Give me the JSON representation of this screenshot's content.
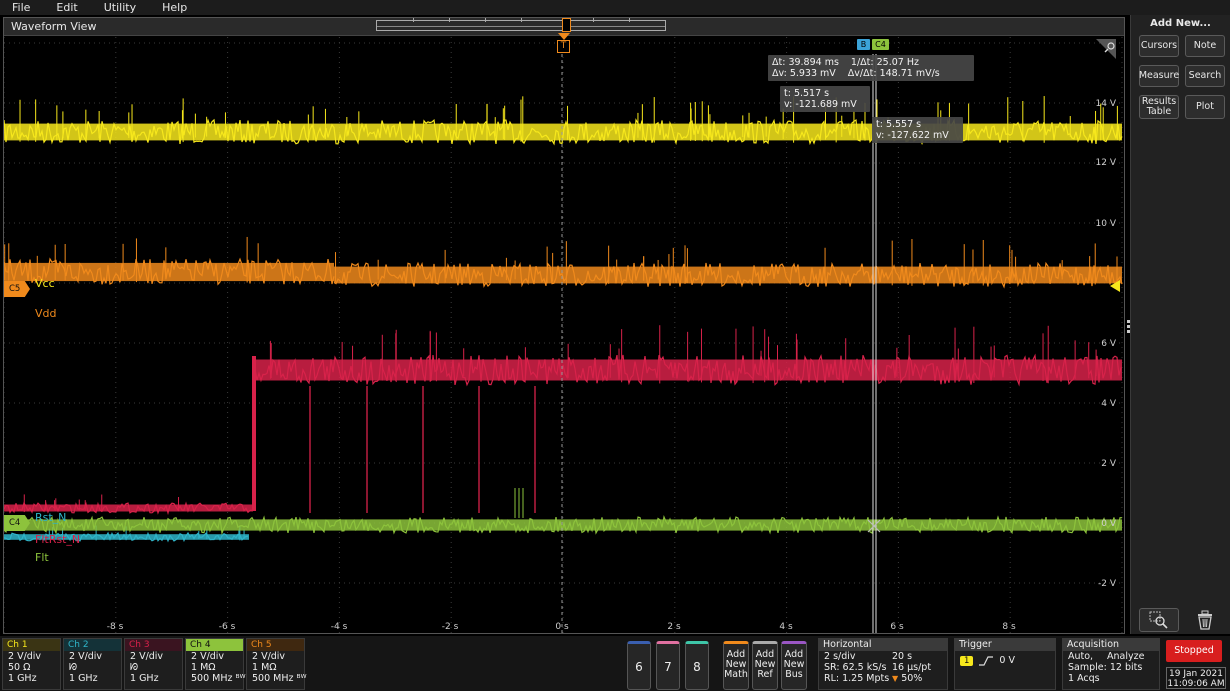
{
  "menu": [
    "File",
    "Edit",
    "Utility",
    "Help"
  ],
  "waveform_view": {
    "title": "Waveform View",
    "trigger_marker": "T",
    "y_labels": [
      "14 V",
      "12 V",
      "10 V",
      "6 V",
      "4 V",
      "2 V",
      "0 V",
      "-2 V"
    ],
    "x_labels": [
      "-8 s",
      "-6 s",
      "-4 s",
      "-2 s",
      "0 s",
      "2 s",
      "4 s",
      "6 s",
      "8 s"
    ],
    "cursor_badges": [
      "B",
      "C4"
    ],
    "delta_readout": {
      "dt": "Δt: 39.894 ms",
      "inv_dt": "1/Δt: 25.07 Hz",
      "dv": "Δv: 5.933 mV",
      "dv_dt": "Δv/Δt: 148.71 mV/s"
    },
    "cursor_a_readout": {
      "t": "t: 5.517 s",
      "v": "v: -121.689 mV"
    },
    "cursor_b_readout": {
      "t": "t: 5.557 s",
      "v": "v: -127.622 mV"
    },
    "channel_flags": {
      "c5": "C5",
      "c4": "C4"
    },
    "waveform_labels": {
      "vcc": "Vcc",
      "vdd": "Vdd",
      "rst": "Rst_N",
      "fltrst": "FltRst_N",
      "flt": "Flt"
    }
  },
  "right_panel": {
    "title": "Add New...",
    "buttons": [
      "Cursors",
      "Note",
      "Measure",
      "Search",
      "Results Table",
      "Plot"
    ]
  },
  "channels": [
    {
      "name": "Ch 1",
      "lines": [
        "2 V/div",
        "50 Ω",
        "1 GHz"
      ],
      "color": "#f7e81c"
    },
    {
      "name": "Ch 2",
      "lines": [
        "2 V/div",
        "ᘗ",
        "1 GHz"
      ],
      "color": "#2fb5c9"
    },
    {
      "name": "Ch 3",
      "lines": [
        "2 V/div",
        "ᘗ",
        "1 GHz"
      ],
      "color": "#d8224a"
    },
    {
      "name": "Ch 4",
      "lines": [
        "2 V/div",
        "1 MΩ",
        "500 MHz ᴮᵂ"
      ],
      "color": "#8dc33c"
    },
    {
      "name": "Ch 5",
      "lines": [
        "2 V/div",
        "1 MΩ",
        "500 MHz ᴮᵂ"
      ],
      "color": "#f08a1c"
    }
  ],
  "extra_channels": [
    "6",
    "7",
    "8"
  ],
  "add_buttons": [
    {
      "label": "Add New Math",
      "color": "#f08a1c"
    },
    {
      "label": "Add New Ref",
      "color": "#aaaaaa"
    },
    {
      "label": "Add New Bus",
      "color": "#9a56c4"
    }
  ],
  "horizontal": {
    "title": "Horizontal",
    "scale": "2 s/div",
    "record": "20 s",
    "sr": "SR: 62.5 kS/s",
    "pt": "16 µs/pt",
    "rl": "RL: 1.25 Mpts",
    "pos": "50%"
  },
  "trigger": {
    "title": "Trigger",
    "source": "1",
    "level": "0 V"
  },
  "acquisition": {
    "title": "Acquisition",
    "mode": "Auto,",
    "analyze": "Analyze",
    "sample": "Sample: 12 bits",
    "acqs": "1 Acqs"
  },
  "status": {
    "state": "Stopped",
    "date": "19 Jan 2021",
    "time": "11:09:06 AM"
  }
}
